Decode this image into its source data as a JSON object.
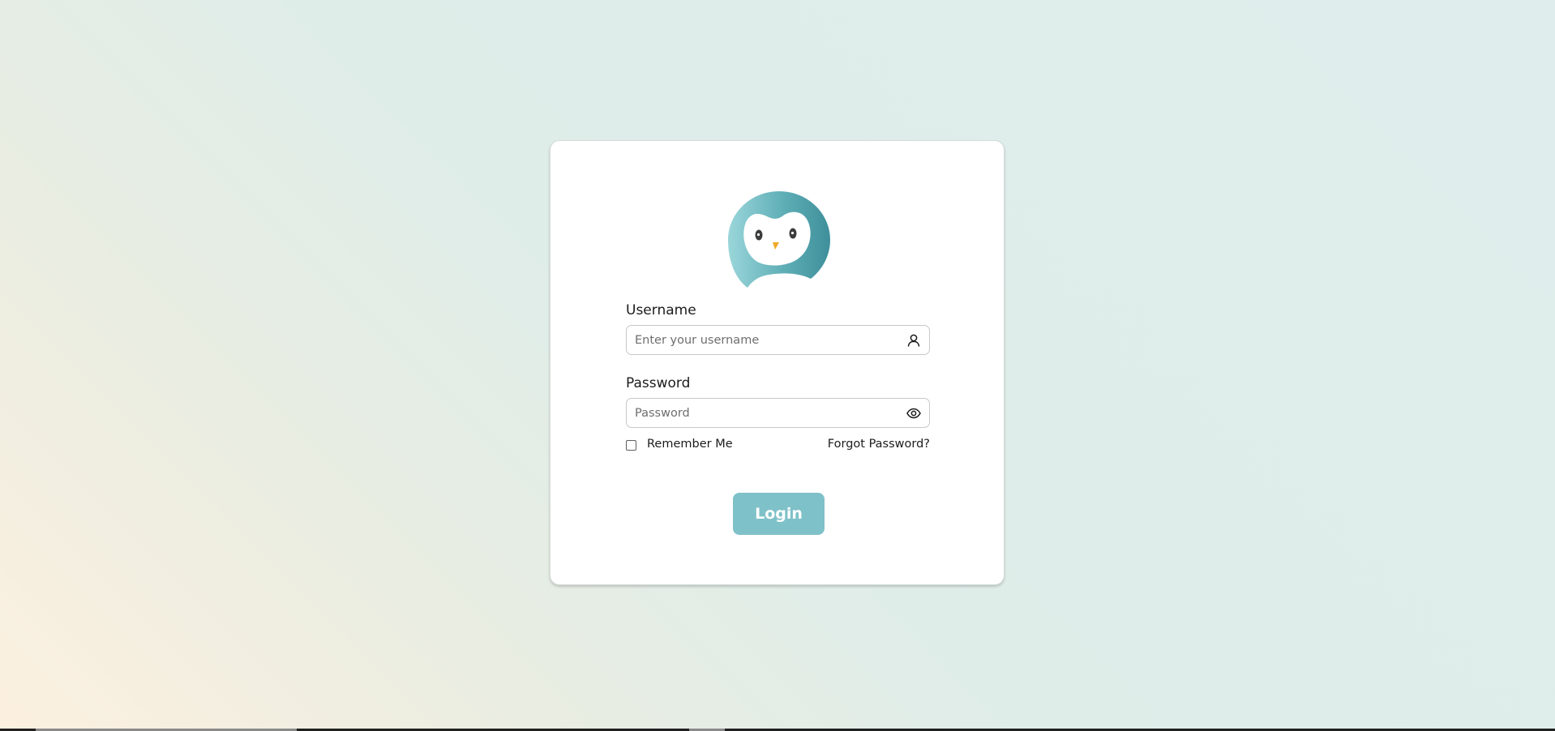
{
  "login": {
    "logo_icon": "owl-logo-icon",
    "username": {
      "label": "Username",
      "placeholder": "Enter your username",
      "value": "",
      "icon": "user-icon"
    },
    "password": {
      "label": "Password",
      "placeholder": "Password",
      "value": "",
      "icon": "eye-icon"
    },
    "remember_me": {
      "label": "Remember Me",
      "checked": false
    },
    "forgot_password_label": "Forgot Password?",
    "login_button_label": "Login"
  },
  "colors": {
    "accent": "#7fc1c8",
    "logo_teal": "#4f9ea8",
    "beak": "#f0a928"
  }
}
